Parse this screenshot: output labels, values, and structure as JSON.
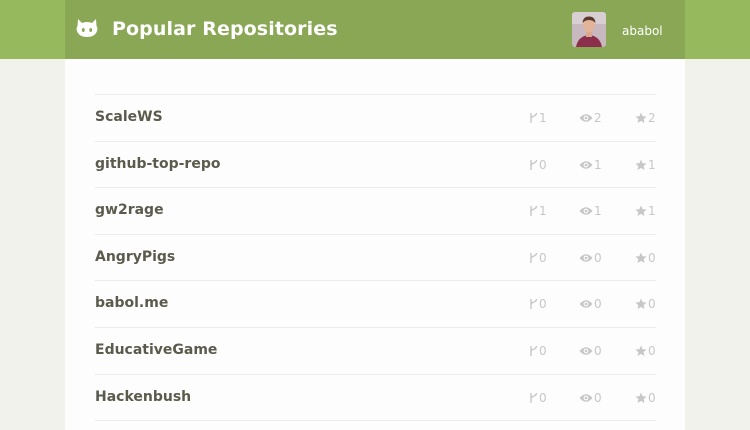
{
  "header": {
    "title": "Popular Repositories",
    "username": "ababol",
    "logo_icon": "github-octocat-icon",
    "brand_color": "#89a755",
    "bar_color": "#95b95c"
  },
  "repositories": [
    {
      "name": "ScaleWS",
      "forks": "1",
      "watchers": "2",
      "stars": "2"
    },
    {
      "name": "github-top-repo",
      "forks": "0",
      "watchers": "1",
      "stars": "1"
    },
    {
      "name": "gw2rage",
      "forks": "1",
      "watchers": "1",
      "stars": "1"
    },
    {
      "name": "AngryPigs",
      "forks": "0",
      "watchers": "0",
      "stars": "0"
    },
    {
      "name": "babol.me",
      "forks": "0",
      "watchers": "0",
      "stars": "0"
    },
    {
      "name": "EducativeGame",
      "forks": "0",
      "watchers": "0",
      "stars": "0"
    },
    {
      "name": "Hackenbush",
      "forks": "0",
      "watchers": "0",
      "stars": "0"
    }
  ],
  "icons": {
    "forks": "fork-icon",
    "watchers": "eye-icon",
    "stars": "star-icon"
  }
}
